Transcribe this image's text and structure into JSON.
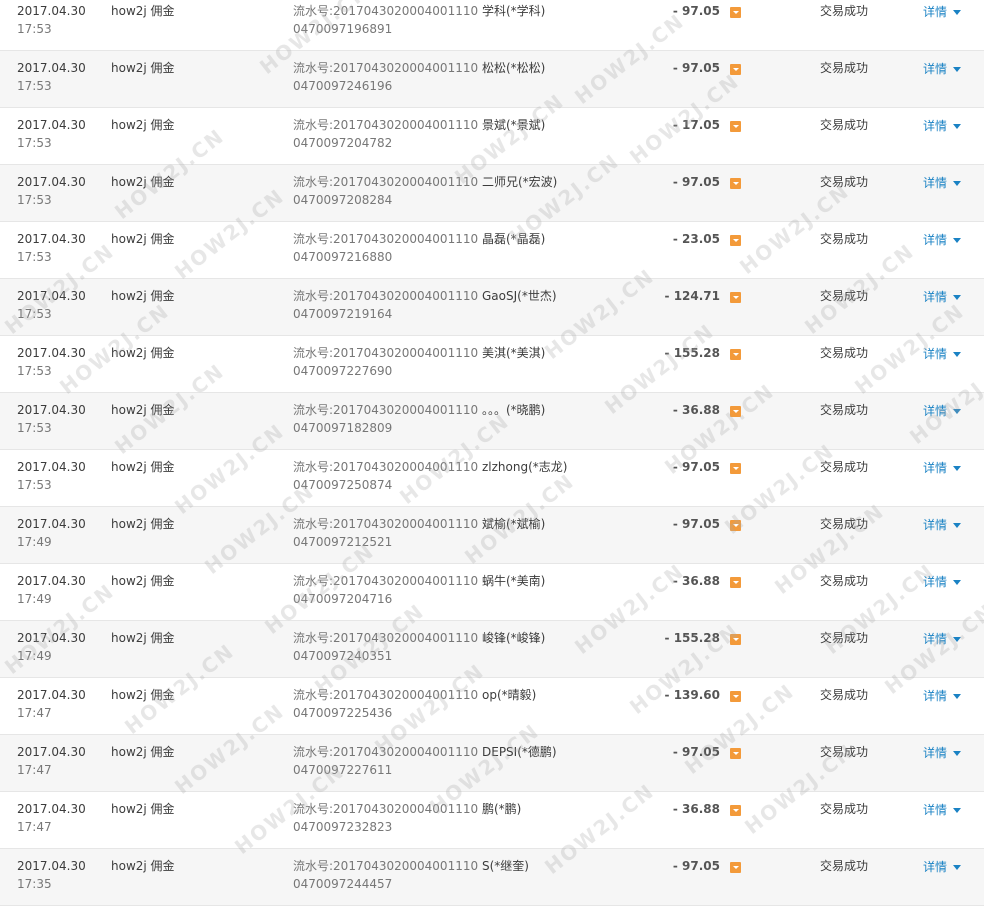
{
  "watermark": {
    "text": "HOW2J.CN",
    "color": "#aaaaaa"
  },
  "colors": {
    "link": "#1a82c4",
    "amount_icon": "#f39a3a",
    "row_alt": "#f6f6f6",
    "border": "#e6e6e6"
  },
  "rows": [
    {
      "date": "2017.04.30",
      "time": "17:53",
      "name": "how2j 佣金",
      "serial1": "流水号:2017043020004001110",
      "serial2": "0470097196891",
      "party": "学科(*学科)",
      "amount": "- 97.05",
      "status": "交易成功",
      "detail": "详情"
    },
    {
      "date": "2017.04.30",
      "time": "17:53",
      "name": "how2j 佣金",
      "serial1": "流水号:2017043020004001110",
      "serial2": "0470097246196",
      "party": "松松(*松松)",
      "amount": "- 97.05",
      "status": "交易成功",
      "detail": "详情"
    },
    {
      "date": "2017.04.30",
      "time": "17:53",
      "name": "how2j 佣金",
      "serial1": "流水号:2017043020004001110",
      "serial2": "0470097204782",
      "party": "景斌(*景斌)",
      "amount": "- 17.05",
      "status": "交易成功",
      "detail": "详情"
    },
    {
      "date": "2017.04.30",
      "time": "17:53",
      "name": "how2j 佣金",
      "serial1": "流水号:2017043020004001110",
      "serial2": "0470097208284",
      "party": "二师兄(*宏波)",
      "amount": "- 97.05",
      "status": "交易成功",
      "detail": "详情"
    },
    {
      "date": "2017.04.30",
      "time": "17:53",
      "name": "how2j 佣金",
      "serial1": "流水号:2017043020004001110",
      "serial2": "0470097216880",
      "party": "晶磊(*晶磊)",
      "amount": "- 23.05",
      "status": "交易成功",
      "detail": "详情"
    },
    {
      "date": "2017.04.30",
      "time": "17:53",
      "name": "how2j 佣金",
      "serial1": "流水号:2017043020004001110",
      "serial2": "0470097219164",
      "party": "GaoSJ(*世杰)",
      "amount": "- 124.71",
      "status": "交易成功",
      "detail": "详情"
    },
    {
      "date": "2017.04.30",
      "time": "17:53",
      "name": "how2j 佣金",
      "serial1": "流水号:2017043020004001110",
      "serial2": "0470097227690",
      "party": "美淇(*美淇)",
      "amount": "- 155.28",
      "status": "交易成功",
      "detail": "详情"
    },
    {
      "date": "2017.04.30",
      "time": "17:53",
      "name": "how2j 佣金",
      "serial1": "流水号:2017043020004001110",
      "serial2": "0470097182809",
      "party": "。。。(*晓鹏)",
      "amount": "- 36.88",
      "status": "交易成功",
      "detail": "详情"
    },
    {
      "date": "2017.04.30",
      "time": "17:53",
      "name": "how2j 佣金",
      "serial1": "流水号:2017043020004001110",
      "serial2": "0470097250874",
      "party": "zlzhong(*志龙)",
      "amount": "- 97.05",
      "status": "交易成功",
      "detail": "详情"
    },
    {
      "date": "2017.04.30",
      "time": "17:49",
      "name": "how2j 佣金",
      "serial1": "流水号:2017043020004001110",
      "serial2": "0470097212521",
      "party": "斌榆(*斌榆)",
      "amount": "- 97.05",
      "status": "交易成功",
      "detail": "详情"
    },
    {
      "date": "2017.04.30",
      "time": "17:49",
      "name": "how2j 佣金",
      "serial1": "流水号:2017043020004001110",
      "serial2": "0470097204716",
      "party": "蜗牛(*美南)",
      "amount": "- 36.88",
      "status": "交易成功",
      "detail": "详情"
    },
    {
      "date": "2017.04.30",
      "time": "17:49",
      "name": "how2j 佣金",
      "serial1": "流水号:2017043020004001110",
      "serial2": "0470097240351",
      "party": "峻锋(*峻锋)",
      "amount": "- 155.28",
      "status": "交易成功",
      "detail": "详情"
    },
    {
      "date": "2017.04.30",
      "time": "17:47",
      "name": "how2j 佣金",
      "serial1": "流水号:2017043020004001110",
      "serial2": "0470097225436",
      "party": "op(*晴毅)",
      "amount": "- 139.60",
      "status": "交易成功",
      "detail": "详情"
    },
    {
      "date": "2017.04.30",
      "time": "17:47",
      "name": "how2j 佣金",
      "serial1": "流水号:2017043020004001110",
      "serial2": "0470097227611",
      "party": "DEPSI(*德鹏)",
      "amount": "- 97.05",
      "status": "交易成功",
      "detail": "详情"
    },
    {
      "date": "2017.04.30",
      "time": "17:47",
      "name": "how2j 佣金",
      "serial1": "流水号:2017043020004001110",
      "serial2": "0470097232823",
      "party": "鹏(*鹏)",
      "amount": "- 36.88",
      "status": "交易成功",
      "detail": "详情"
    },
    {
      "date": "2017.04.30",
      "time": "17:35",
      "name": "how2j 佣金",
      "serial1": "流水号:2017043020004001110",
      "serial2": "0470097244457",
      "party": "S(*继奎)",
      "amount": "- 97.05",
      "status": "交易成功",
      "detail": "详情"
    }
  ]
}
